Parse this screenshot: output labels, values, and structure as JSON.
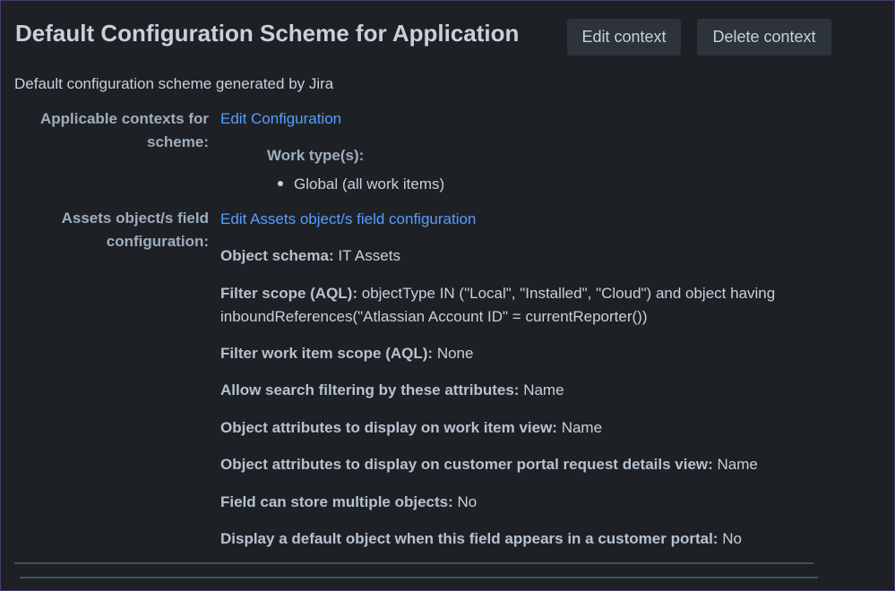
{
  "header": {
    "title": "Default Configuration Scheme for Application",
    "edit_context_label": "Edit context",
    "delete_context_label": "Delete context"
  },
  "description": "Default configuration scheme generated by Jira",
  "contexts": {
    "label": "Applicable contexts for scheme:",
    "edit_link": "Edit Configuration",
    "work_types_heading": "Work type(s):",
    "work_types": [
      "Global (all work items)"
    ]
  },
  "assets": {
    "label": "Assets object/s field configuration:",
    "edit_link": "Edit Assets object/s field configuration",
    "rows": [
      {
        "key": "Object schema:",
        "value": "IT Assets"
      },
      {
        "key": "Filter scope (AQL):",
        "value": "objectType IN (\"Local\", \"Installed\", \"Cloud\") and object having inboundReferences(\"Atlassian Account ID\" = currentReporter())"
      },
      {
        "key": "Filter work item scope (AQL):",
        "value": "None"
      },
      {
        "key": "Allow search filtering by these attributes:",
        "value": "Name"
      },
      {
        "key": "Object attributes to display on work item view:",
        "value": "Name"
      },
      {
        "key": "Object attributes to display on customer portal request details view:",
        "value": "Name"
      },
      {
        "key": "Field can store multiple objects:",
        "value": "No"
      },
      {
        "key": "Display a default object when this field appears in a customer portal:",
        "value": "No"
      }
    ]
  },
  "colors": {
    "background": "#1d2125",
    "text": "#c7d1db",
    "link": "#579dff",
    "button": "#2c333a"
  }
}
